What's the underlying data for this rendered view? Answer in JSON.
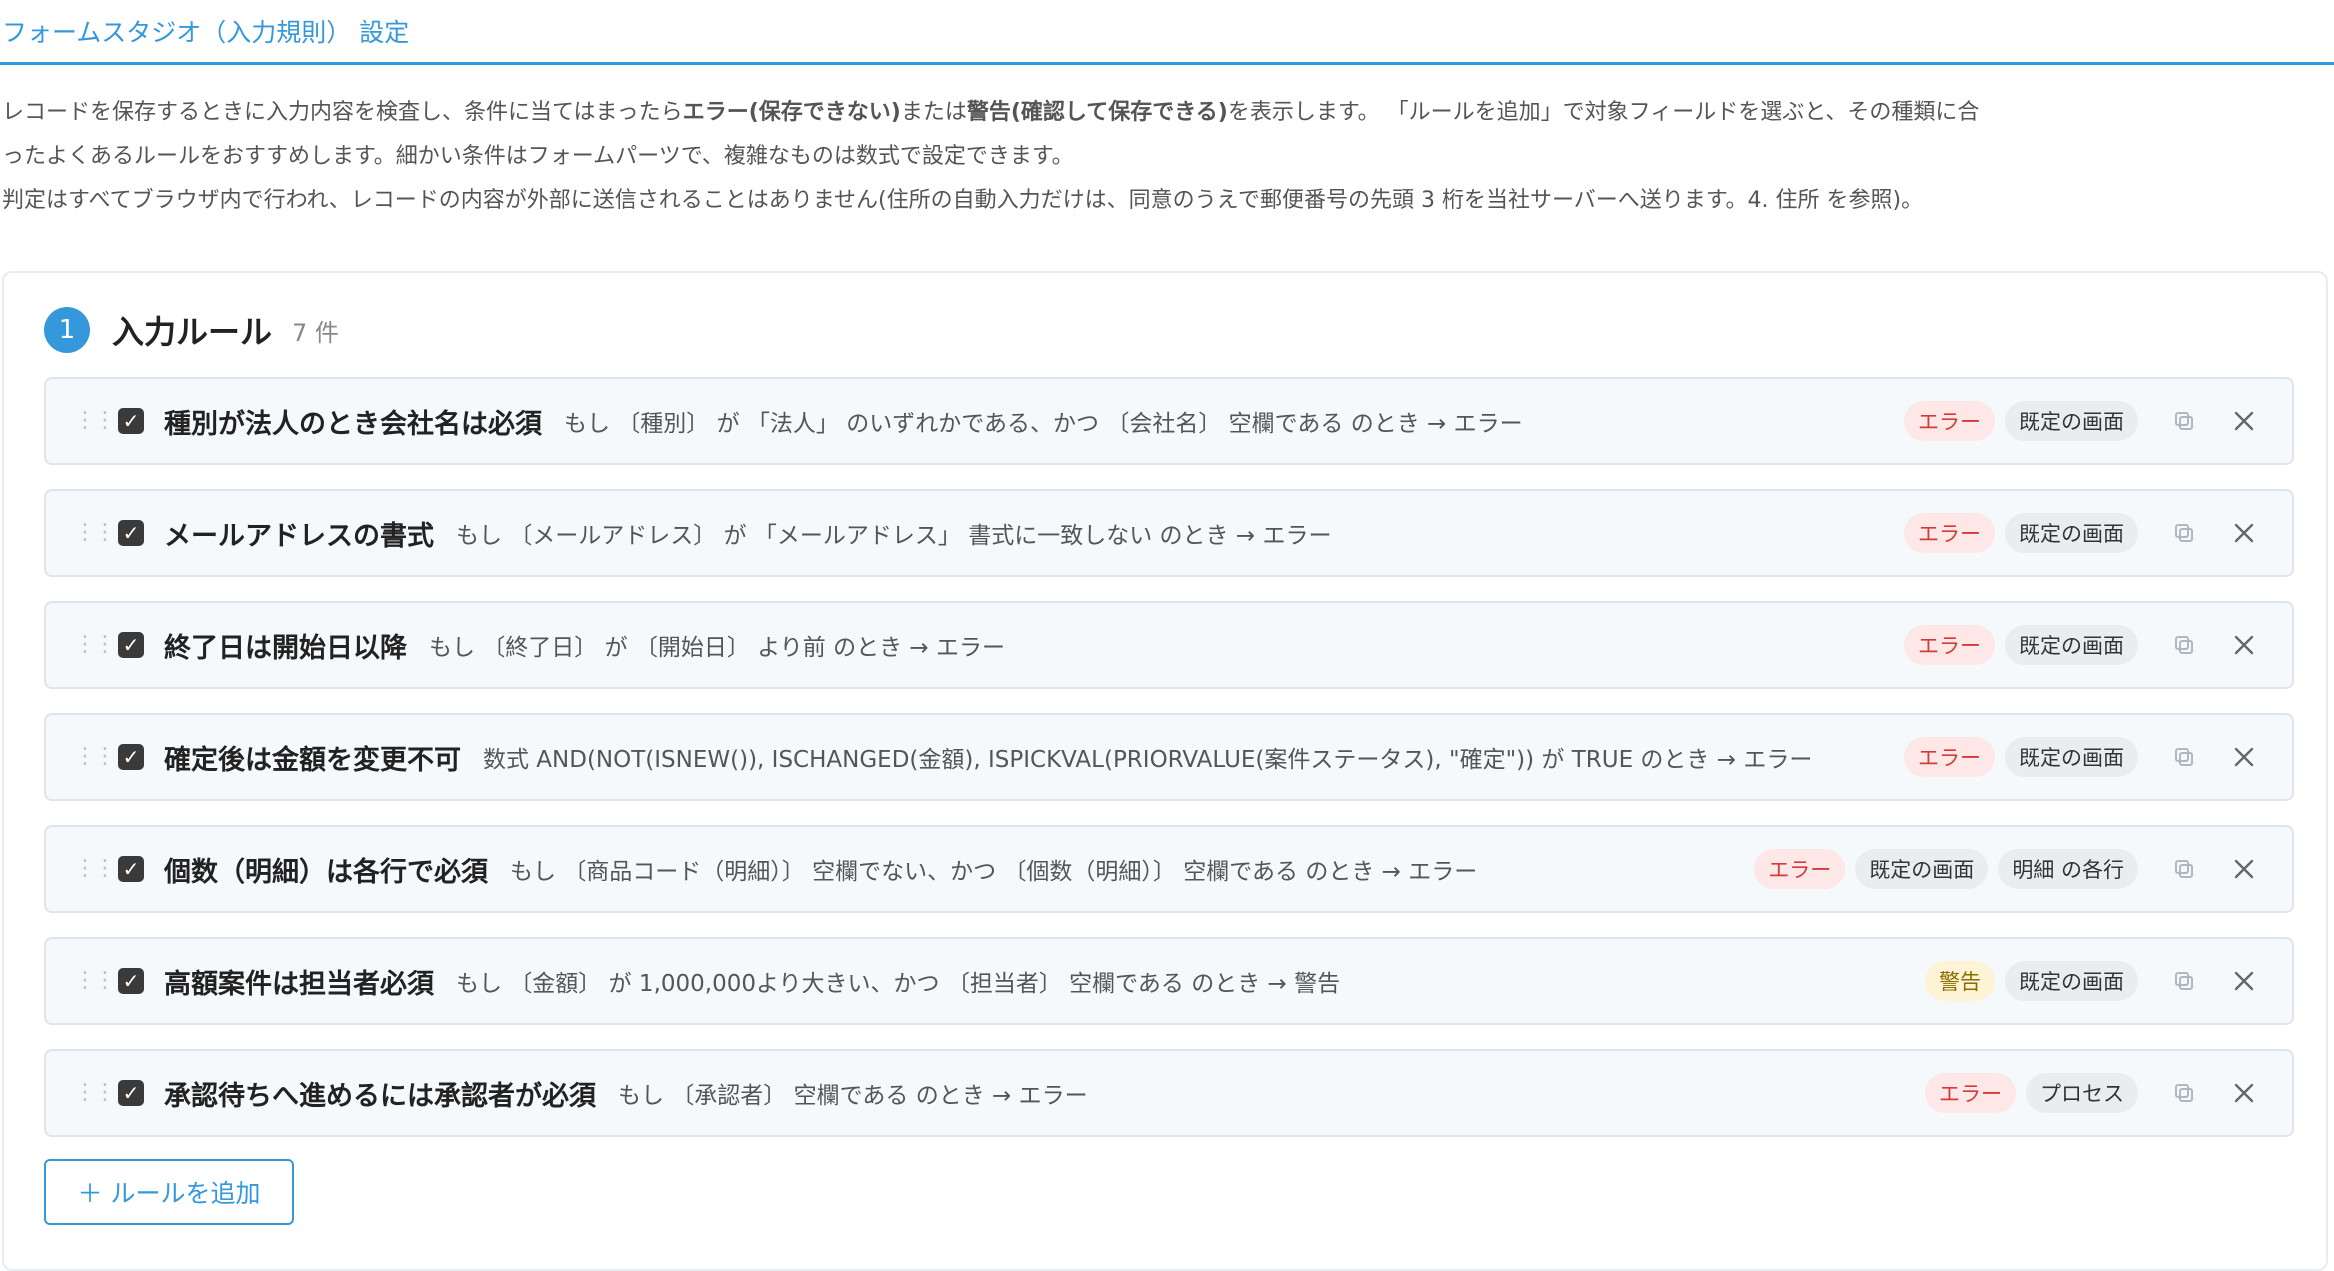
{
  "header": {
    "title": "フォームスタジオ（入力規則） 設定"
  },
  "description": {
    "line1a": "レコードを保存するときに入力内容を検査し、条件に当てはまったら",
    "line1b": "エラー(保存できない)",
    "line1c": "または",
    "line1d": "警告(確認して保存できる)",
    "line1e": "を表示します。 「ルールを追加」で対象フィールドを選ぶと、その種類に合",
    "line2": "ったよくあるルールをおすすめします。細かい条件はフォームパーツで、複雑なものは数式で設定できます。",
    "line3": "判定はすべてブラウザ内で行われ、レコードの内容が外部に送信されることはありません(住所の自動入力だけは、同意のうえで郵便番号の先頭 3 桁を当社サーバーへ送ります。4. 住所 を参照)。"
  },
  "panel": {
    "step": "1",
    "title": "入力ルール",
    "count": "7 件"
  },
  "rules": [
    {
      "name": "種別が法人のとき会社名は必須",
      "condition": "もし 〔種別〕 が 「法人」 のいずれかである、かつ 〔会社名〕 空欄である のとき → エラー",
      "severity": "エラー",
      "scope": "既定の画面",
      "extra": ""
    },
    {
      "name": "メールアドレスの書式",
      "condition": "もし 〔メールアドレス〕 が 「メールアドレス」 書式に一致しない のとき → エラー",
      "severity": "エラー",
      "scope": "既定の画面",
      "extra": ""
    },
    {
      "name": "終了日は開始日以降",
      "condition": "もし 〔終了日〕 が 〔開始日〕 より前 のとき → エラー",
      "severity": "エラー",
      "scope": "既定の画面",
      "extra": ""
    },
    {
      "name": "確定後は金額を変更不可",
      "condition": "数式 AND(NOT(ISNEW()), ISCHANGED(金額), ISPICKVAL(PRIORVALUE(案件ステータス), \"確定\")) が TRUE のとき → エラー",
      "severity": "エラー",
      "scope": "既定の画面",
      "extra": ""
    },
    {
      "name": "個数（明細）は各行で必須",
      "condition": "もし 〔商品コード（明細）〕 空欄でない、かつ 〔個数（明細）〕 空欄である のとき → エラー",
      "severity": "エラー",
      "scope": "既定の画面",
      "extra": "明細 の各行"
    },
    {
      "name": "高額案件は担当者必須",
      "condition": "もし 〔金額〕 が 1,000,000より大きい、かつ 〔担当者〕 空欄である のとき → 警告",
      "severity": "警告",
      "scope": "既定の画面",
      "extra": ""
    },
    {
      "name": "承認待ちへ進めるには承認者が必須",
      "condition": "もし 〔承認者〕 空欄である のとき → エラー",
      "severity": "エラー",
      "scope": "プロセス",
      "extra": ""
    }
  ],
  "add_button": {
    "label": "＋ ルールを追加"
  },
  "icons": {
    "drag": "drag-handle-icon",
    "check": "check-icon",
    "copy": "copy-icon",
    "close": "close-icon"
  },
  "colors": {
    "accent": "#3498db",
    "error_bg": "#fde7e7",
    "error_fg": "#d23b3b",
    "warn_bg": "#fdf4d6",
    "warn_fg": "#8a6d00"
  }
}
